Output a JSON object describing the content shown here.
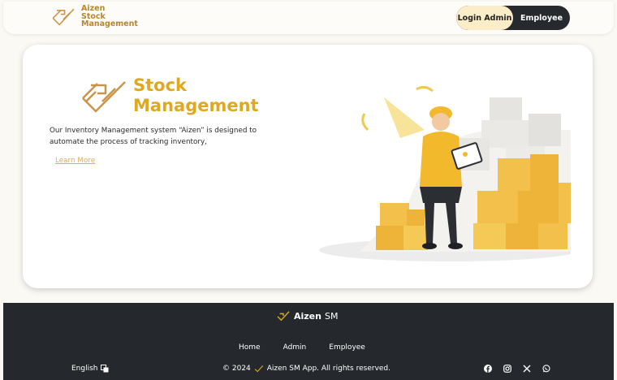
{
  "header": {
    "logo_lines": [
      "Aizen",
      "Stock",
      "Management"
    ],
    "login_admin_label": "Login Admin",
    "employee_label": "Employee"
  },
  "hero": {
    "title_line1": "Stock",
    "title_line2": "Management",
    "description": "Our Inventory Management system “Aizen” is designed to automate the process of tracking inventory,",
    "learn_more_label": "Learn More"
  },
  "footer": {
    "brand_bold": "Aizen",
    "brand_rest": " SM",
    "nav": [
      "Home",
      "Admin",
      "Employee"
    ],
    "language": "English",
    "copyright_pre": "© 2024",
    "copyright_post": "Aizen SM App. All rights reserved.",
    "social_icons": [
      "facebook-icon",
      "instagram-icon",
      "x-icon",
      "whatsapp-icon"
    ]
  },
  "colors": {
    "accent": "#e0a821",
    "dark": "#25292d",
    "toggle_active": "#fbedc7",
    "background": "#fbf9f3"
  }
}
